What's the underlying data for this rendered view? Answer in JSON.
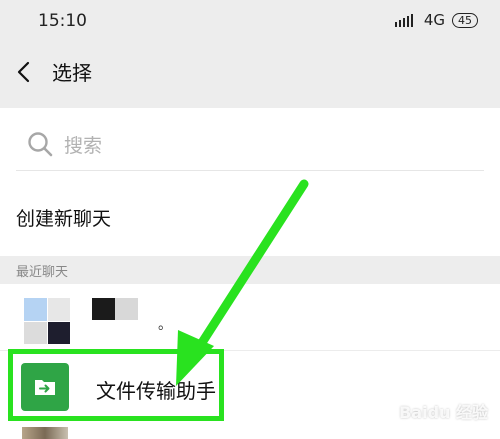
{
  "status_bar": {
    "time": "15:10",
    "network": "4G",
    "battery": "45"
  },
  "header": {
    "title": "选择"
  },
  "search": {
    "placeholder": "搜索"
  },
  "new_chat": {
    "label": "创建新聊天"
  },
  "recent": {
    "section_label": "最近聊天",
    "items": [
      {
        "name": "。",
        "avatar_colors": [
          "#b5d3f3",
          "#e7e7e7",
          "#dcdcdc",
          "#1e1e2e"
        ]
      },
      {
        "name": "文件传输助手",
        "avatar_color": "#2fa546",
        "icon": "folder-transfer-icon"
      }
    ]
  },
  "colors": {
    "highlight": "#29e21f",
    "background": "#ededed"
  },
  "watermark": "Baidu 经验"
}
